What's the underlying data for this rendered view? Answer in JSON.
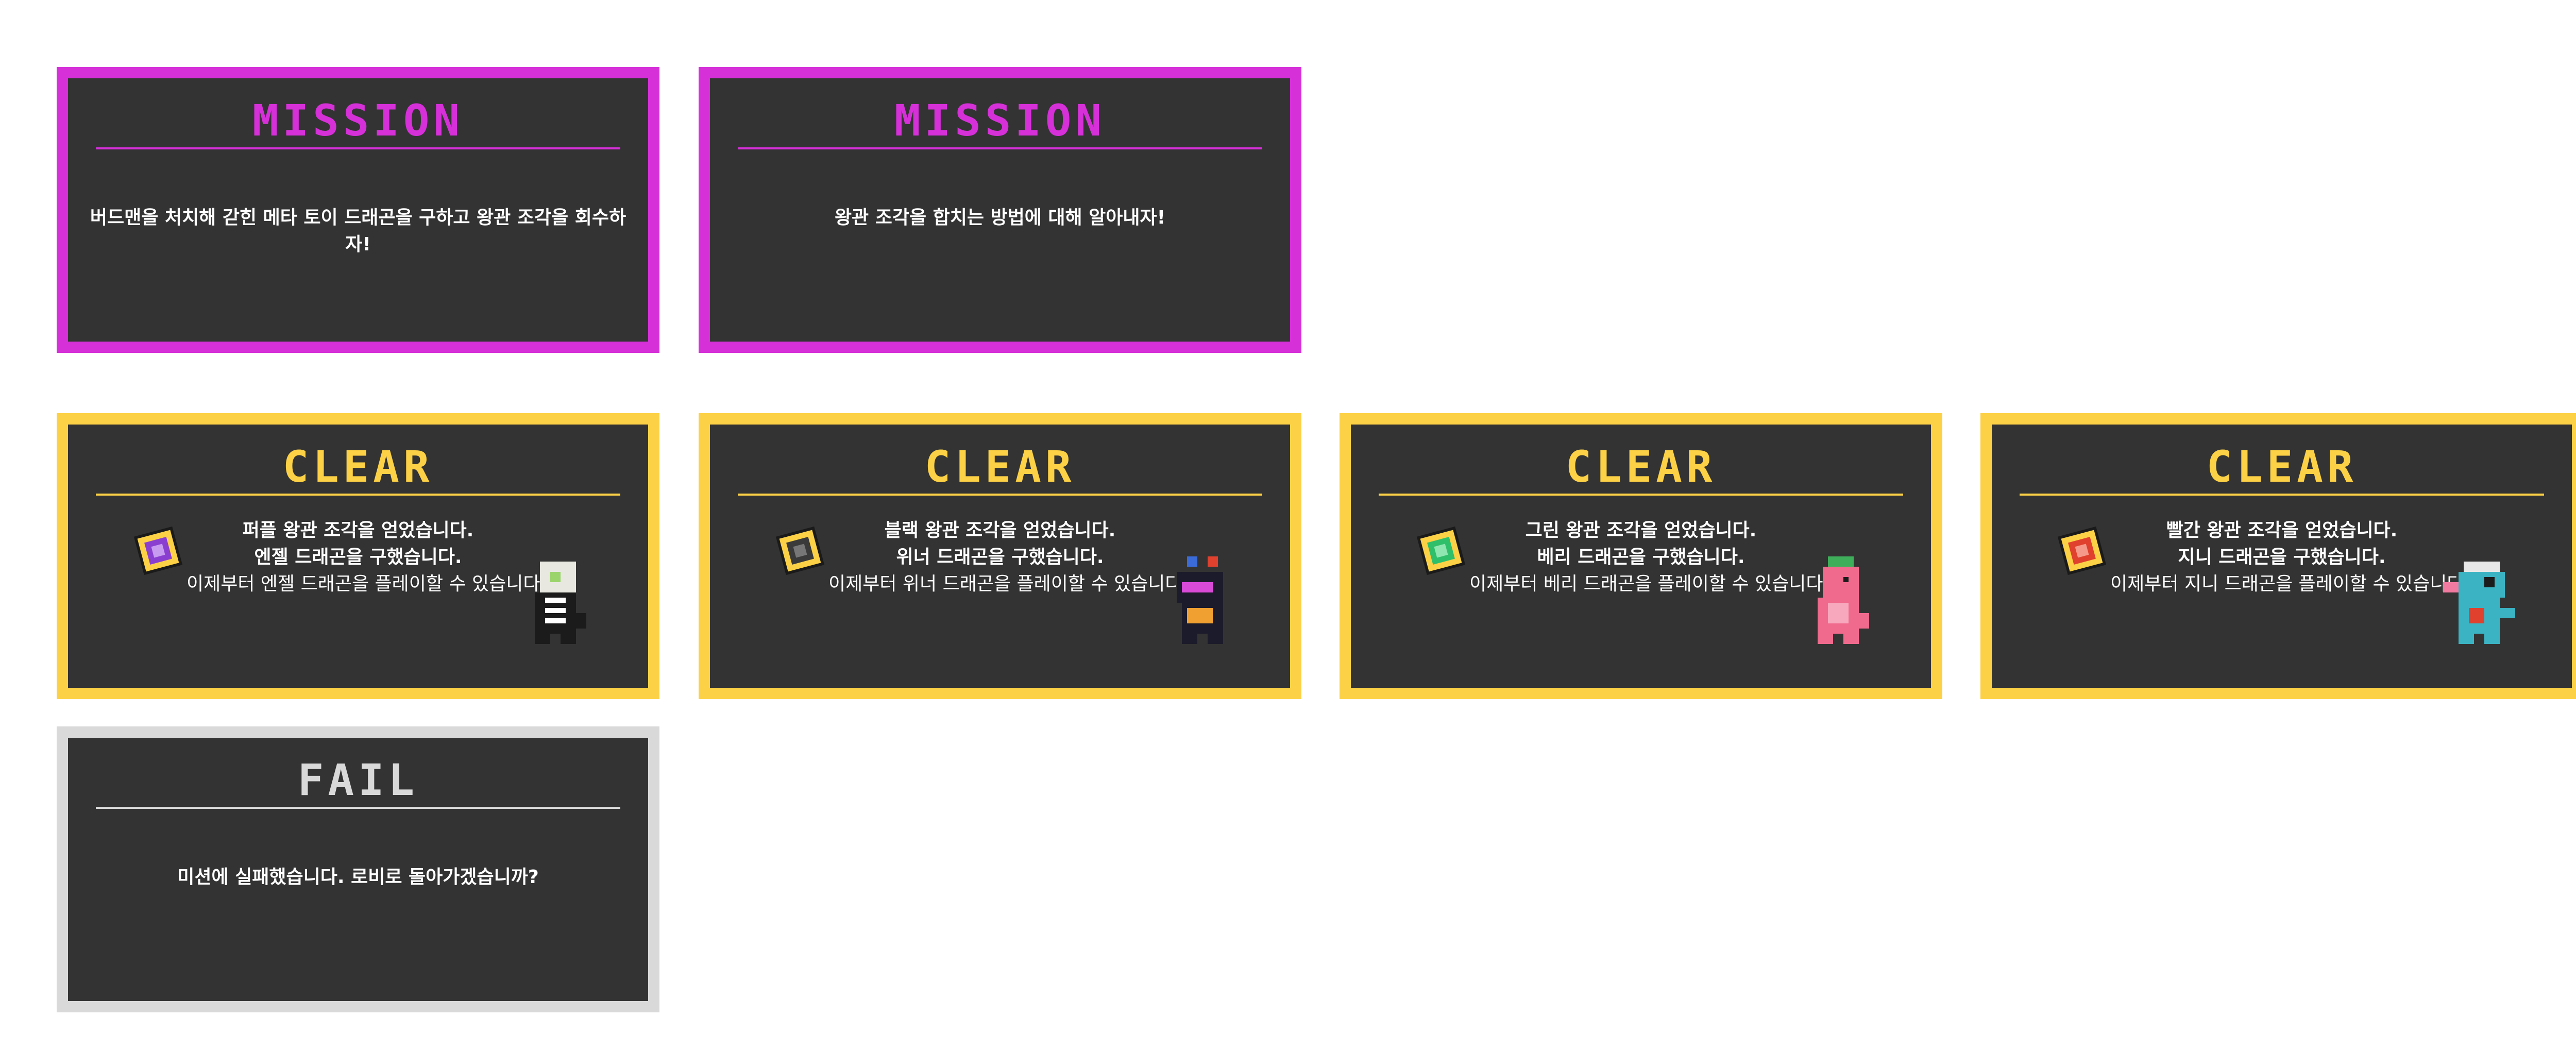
{
  "mission_cards": [
    {
      "title": "MISSION",
      "message": "버드맨을 처치해 갇힌 메타 토이 드래곤을 구하고 왕관 조각을 회수하자!"
    },
    {
      "title": "MISSION",
      "message": "왕관 조각을 합치는 방법에 대해 알아내자!"
    }
  ],
  "clear_cards": [
    {
      "title": "CLEAR",
      "line1": "퍼플 왕관 조각을 얻었습니다.",
      "line2": "엔젤 드래곤을 구했습니다.",
      "line3": "이제부터 엔젤 드래곤을 플레이할 수 있습니다.",
      "crown_icon": "purple-crown-piece-icon",
      "crown_color": "#8a3fd1",
      "dragon_icon": "angel-dragon-icon"
    },
    {
      "title": "CLEAR",
      "line1": "블랙 왕관 조각을 얻었습니다.",
      "line2": "위너 드래곤을 구했습니다.",
      "line3": "이제부터 위너 드래곤을 플레이할 수 있습니다.",
      "crown_icon": "black-crown-piece-icon",
      "crown_color": "#3a3a3a",
      "dragon_icon": "winner-dragon-icon"
    },
    {
      "title": "CLEAR",
      "line1": "그린 왕관 조각을 얻었습니다.",
      "line2": "베리 드래곤을 구했습니다.",
      "line3": "이제부터 베리 드래곤을 플레이할 수 있습니다.",
      "crown_icon": "green-crown-piece-icon",
      "crown_color": "#2fbf6a",
      "dragon_icon": "berry-dragon-icon"
    },
    {
      "title": "CLEAR",
      "line1": "빨간 왕관 조각을 얻었습니다.",
      "line2": "지니 드래곤을 구했습니다.",
      "line3": "이제부터 지니 드래곤을 플레이할 수 있습니다.",
      "crown_icon": "red-crown-piece-icon",
      "crown_color": "#e0402e",
      "dragon_icon": "genie-dragon-icon"
    }
  ],
  "fail_card": {
    "title": "FAIL",
    "message": "미션에 실패했습니다. 로비로 돌아가겠습니까?"
  },
  "colors": {
    "mission": "#d630d9",
    "clear": "#fdd145",
    "fail": "#d9d9d9",
    "panel": "#333333"
  }
}
